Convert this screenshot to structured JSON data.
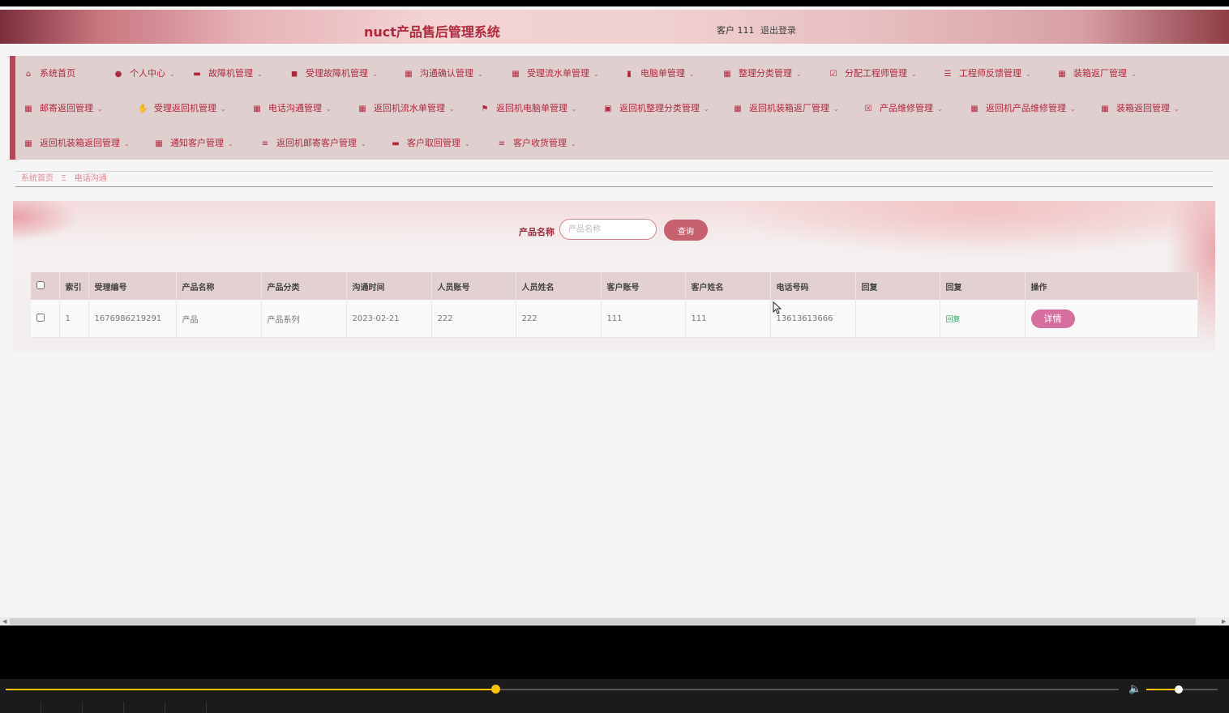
{
  "header": {
    "title": "nuct产品售后管理系统",
    "user_label": "客户 111",
    "logout": "退出登录"
  },
  "nav": {
    "items": [
      {
        "label": "系统首页",
        "icon": "home-icon"
      },
      {
        "label": "个人中心",
        "icon": "user-icon"
      },
      {
        "label": "故障机管理",
        "icon": "monitor-icon"
      },
      {
        "label": "受理故障机管理",
        "icon": "camera-icon"
      },
      {
        "label": "沟通确认管理",
        "icon": "grid-icon"
      },
      {
        "label": "受理流水单管理",
        "icon": "grid-icon"
      },
      {
        "label": "电脑单管理",
        "icon": "chart-icon"
      },
      {
        "label": "整理分类管理",
        "icon": "grid-icon"
      },
      {
        "label": "分配工程师管理",
        "icon": "check-square-icon"
      },
      {
        "label": "工程师反馈管理",
        "icon": "sliders-icon"
      },
      {
        "label": "装箱返厂管理",
        "icon": "grid-icon"
      },
      {
        "label": "邮寄返回管理",
        "icon": "grid-icon"
      },
      {
        "label": "受理返回机管理",
        "icon": "thumbs-up-icon"
      },
      {
        "label": "电话沟通管理",
        "icon": "grid-icon"
      },
      {
        "label": "返回机流水单管理",
        "icon": "grid-icon"
      },
      {
        "label": "返回机电脑单管理",
        "icon": "flag-icon"
      },
      {
        "label": "返回机整理分类管理",
        "icon": "calendar-check-icon"
      },
      {
        "label": "返回机装箱返厂管理",
        "icon": "grid-icon"
      },
      {
        "label": "产品维修管理",
        "icon": "calendar-x-icon"
      },
      {
        "label": "返回机产品维修管理",
        "icon": "grid-icon"
      },
      {
        "label": "装箱返回管理",
        "icon": "grid-icon"
      },
      {
        "label": "返回机装箱返回管理",
        "icon": "grid-icon"
      },
      {
        "label": "通知客户管理",
        "icon": "grid-icon"
      },
      {
        "label": "返回机邮寄客户管理",
        "icon": "list-icon"
      },
      {
        "label": "客户取回管理",
        "icon": "monitor-icon"
      },
      {
        "label": "客户收货管理",
        "icon": "list-icon"
      }
    ]
  },
  "breadcrumb": {
    "home": "系统首页",
    "separator": "Ξ",
    "current": "电话沟通"
  },
  "search": {
    "label": "产品名称",
    "placeholder": "产品名称",
    "value": "",
    "button": "查询"
  },
  "table": {
    "columns": [
      "",
      "索引",
      "受理编号",
      "产品名称",
      "产品分类",
      "沟通时间",
      "人员账号",
      "人员姓名",
      "客户账号",
      "客户姓名",
      "电话号码",
      "回复",
      "回复",
      "操作"
    ],
    "rows": [
      {
        "index": "1",
        "accept_no": "1676986219291",
        "product_name": "产品",
        "product_category": "产品系列",
        "communication_time": "2023-02-21",
        "staff_account": "222",
        "staff_name": "222",
        "customer_account": "111",
        "customer_name": "111",
        "phone": "13613613666",
        "reply_text": "",
        "reply_link": "回复",
        "action": "详情"
      }
    ]
  },
  "player": {
    "progress_fraction": 0.44,
    "volume_fraction": 0.45
  },
  "colors": {
    "brand": "#b0283c",
    "accent_button": "#c7616e",
    "detail_button": "#d66fa0",
    "reply_link": "#3aa56b",
    "seek_color": "#f5c400"
  }
}
